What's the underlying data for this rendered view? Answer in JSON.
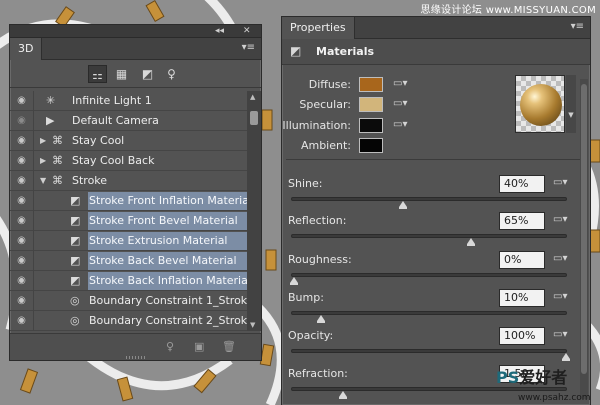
{
  "watermark": {
    "top": "思缘设计论坛 www.MISSYUAN.COM",
    "logo_ps": "PS",
    "logo_cn": "爱好者",
    "url": "www.psahz.com"
  },
  "panel3d": {
    "collapse_glyph": "◂◂",
    "close_glyph": "✕",
    "tab": "3D",
    "filters": [
      {
        "icon": "whole-scene-icon",
        "glyph": "⚏",
        "active": true
      },
      {
        "icon": "meshes-icon",
        "glyph": "▦",
        "active": false
      },
      {
        "icon": "materials-icon",
        "glyph": "◩",
        "active": false
      },
      {
        "icon": "lights-icon",
        "glyph": "♀",
        "active": false
      }
    ],
    "rows": [
      {
        "label": "Infinite Light 1",
        "icon": "light-icon",
        "glyph": "✳",
        "indent": 0,
        "expand": "",
        "visible": true,
        "selected": false
      },
      {
        "label": "Default Camera",
        "icon": "camera-icon",
        "glyph": "▶",
        "indent": 0,
        "expand": "",
        "visible": false,
        "selected": false
      },
      {
        "label": "Stay  Cool",
        "icon": "mesh-icon",
        "glyph": "⌘",
        "indent": 0,
        "expand": "▶",
        "visible": true,
        "selected": false
      },
      {
        "label": "Stay  Cool Back",
        "icon": "mesh-icon",
        "glyph": "⌘",
        "indent": 0,
        "expand": "▶",
        "visible": true,
        "selected": false
      },
      {
        "label": "Stroke",
        "icon": "mesh-icon",
        "glyph": "⌘",
        "indent": 0,
        "expand": "▼",
        "visible": true,
        "selected": false
      },
      {
        "label": "Stroke Front Inflation Material",
        "icon": "material-icon",
        "glyph": "◩",
        "indent": 1,
        "expand": "",
        "visible": true,
        "selected": true
      },
      {
        "label": "Stroke Front Bevel Material",
        "icon": "material-icon",
        "glyph": "◩",
        "indent": 1,
        "expand": "",
        "visible": true,
        "selected": true
      },
      {
        "label": "Stroke Extrusion Material",
        "icon": "material-icon",
        "glyph": "◩",
        "indent": 1,
        "expand": "",
        "visible": true,
        "selected": true
      },
      {
        "label": "Stroke Back Bevel Material",
        "icon": "material-icon",
        "glyph": "◩",
        "indent": 1,
        "expand": "",
        "visible": true,
        "selected": true
      },
      {
        "label": "Stroke Back Inflation Material",
        "icon": "material-icon",
        "glyph": "◩",
        "indent": 1,
        "expand": "",
        "visible": true,
        "selected": true
      },
      {
        "label": "Boundary Constraint 1_Stroke",
        "icon": "constraint-icon",
        "glyph": "◎",
        "indent": 1,
        "expand": "",
        "visible": true,
        "selected": false
      },
      {
        "label": "Boundary Constraint 2_Stroke",
        "icon": "constraint-icon",
        "glyph": "◎",
        "indent": 1,
        "expand": "",
        "visible": true,
        "selected": false
      }
    ],
    "bottom_icons": [
      {
        "icon": "add-light-icon",
        "glyph": "♀"
      },
      {
        "icon": "render-icon",
        "glyph": "▣"
      },
      {
        "icon": "delete-icon",
        "glyph": "🗑"
      }
    ]
  },
  "props": {
    "close_glyph": "✕",
    "tab": "Properties",
    "subheader": "Materials",
    "colors": [
      {
        "label": "Diffuse:",
        "color": "#a8661c",
        "folder": true
      },
      {
        "label": "Specular:",
        "color": "#d2b57b",
        "folder": true
      },
      {
        "label": "Illumination:",
        "color": "#0b0b0b",
        "folder": true
      },
      {
        "label": "Ambient:",
        "color": "#050505",
        "folder": false
      }
    ],
    "sliders": [
      {
        "label": "Shine:",
        "value": "40%",
        "fraction": 0.4,
        "folder": true
      },
      {
        "label": "Reflection:",
        "value": "65%",
        "fraction": 0.65,
        "folder": true
      },
      {
        "label": "Roughness:",
        "value": "0%",
        "fraction": 0.0,
        "folder": true
      },
      {
        "label": "Bump:",
        "value": "10%",
        "fraction": 0.1,
        "folder": true
      },
      {
        "label": "Opacity:",
        "value": "100%",
        "fraction": 1.0,
        "folder": true
      },
      {
        "label": "Refraction:",
        "value": "1.50",
        "fraction": 0.18,
        "folder": false
      }
    ]
  }
}
